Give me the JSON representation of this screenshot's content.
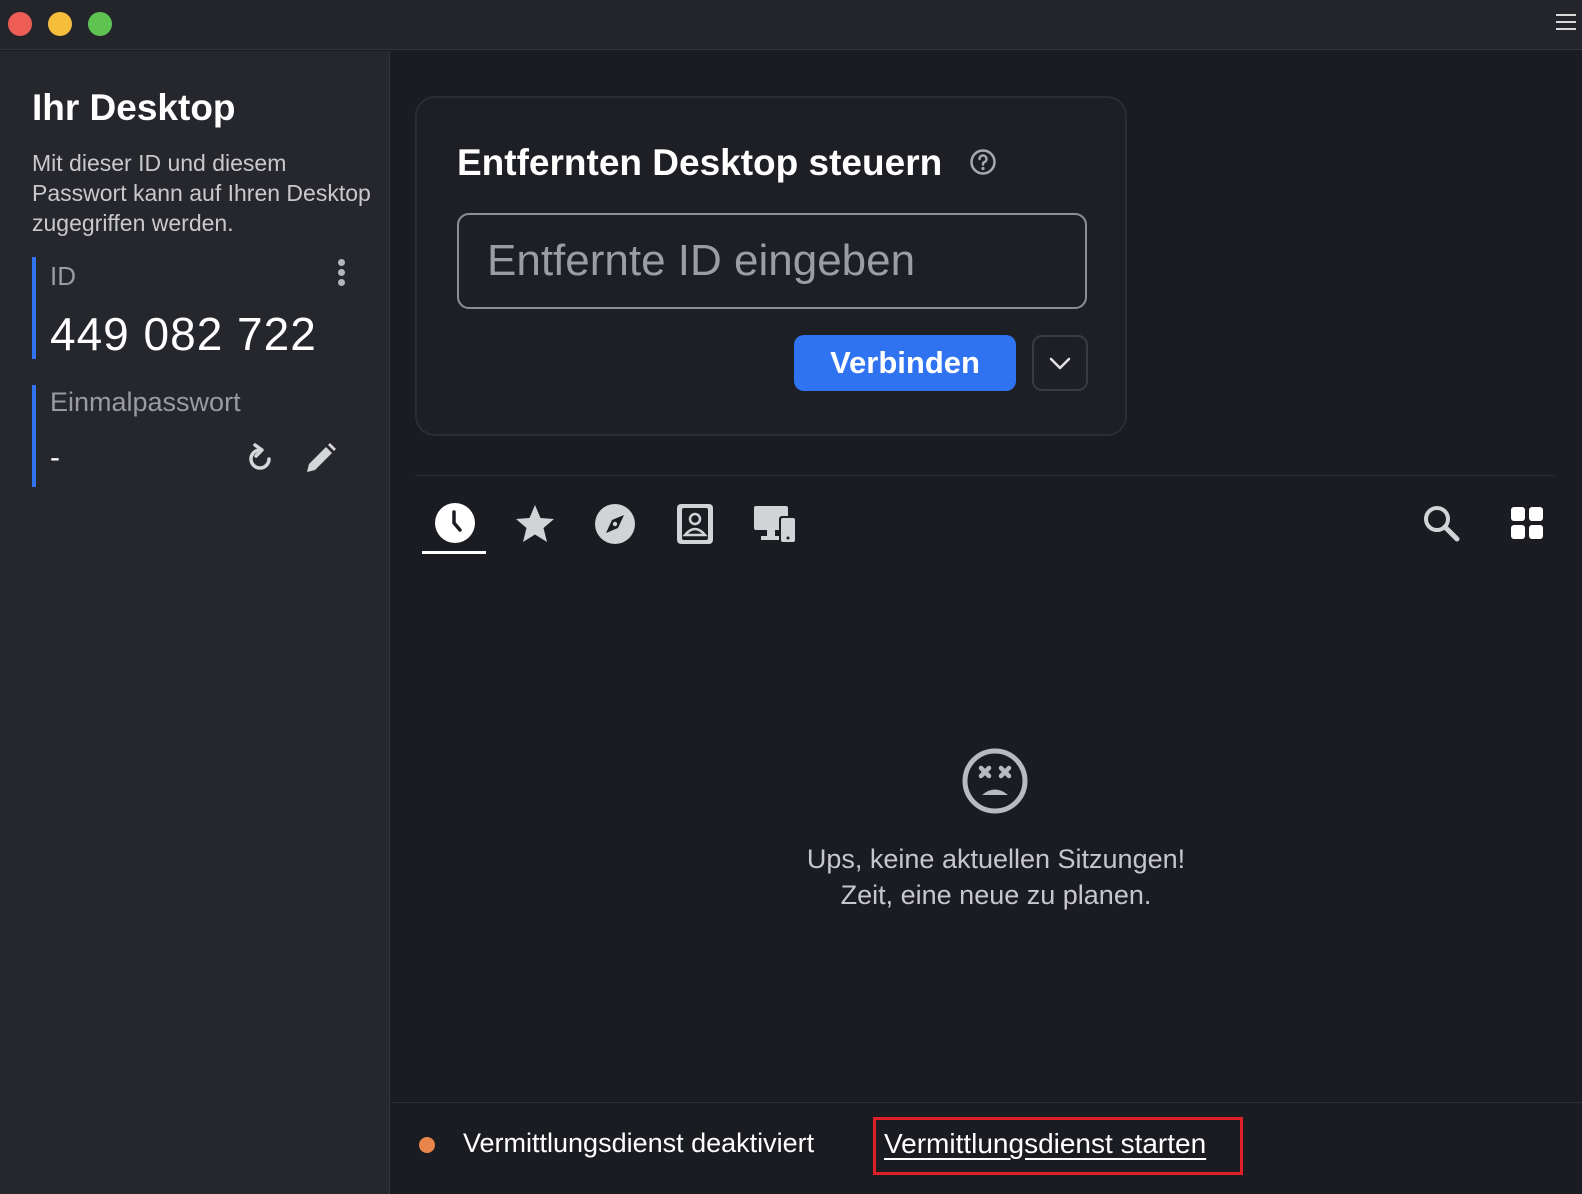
{
  "sidebar": {
    "title": "Ihr Desktop",
    "description": "Mit dieser ID und diesem Passwort kann auf Ihren Desktop zugegriffen werden.",
    "id_label": "ID",
    "id_value": "449 082 722",
    "password_label": "Einmalpasswort",
    "password_value": "-"
  },
  "control": {
    "title": "Entfernten Desktop steuern",
    "input_placeholder": "Entfernte ID eingeben",
    "input_value": "",
    "connect_label": "Verbinden"
  },
  "tabs": [
    {
      "icon": "clock-icon",
      "active": true
    },
    {
      "icon": "star-icon",
      "active": false
    },
    {
      "icon": "compass-icon",
      "active": false
    },
    {
      "icon": "address-book-icon",
      "active": false
    },
    {
      "icon": "devices-icon",
      "active": false
    }
  ],
  "empty_state": {
    "icon": "sad-face-icon",
    "line1": "Ups, keine aktuellen Sitzungen!",
    "line2": "Zeit, eine neue zu planen."
  },
  "status": {
    "text": "Vermittlungsdienst deaktiviert",
    "action_label": "Vermittlungsdienst starten",
    "dot_color": "#e8854a",
    "highlight_color": "#e01e26"
  },
  "colors": {
    "accent": "#2f73f0"
  }
}
